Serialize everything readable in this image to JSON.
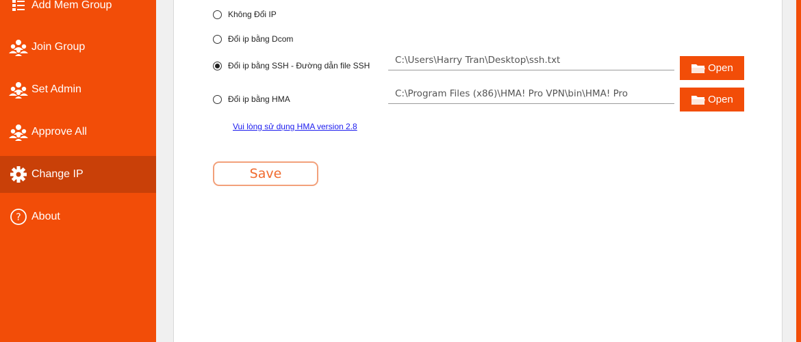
{
  "sidebar": {
    "items": [
      {
        "label": "Add Mem Group",
        "icon": "list-icon"
      },
      {
        "label": "Join Group",
        "icon": "group-icon"
      },
      {
        "label": "Set Admin",
        "icon": "group-icon"
      },
      {
        "label": "Approve All",
        "icon": "group-icon"
      },
      {
        "label": "Change IP",
        "icon": "gear-icon",
        "active": true
      },
      {
        "label": "About",
        "icon": "question-icon"
      }
    ]
  },
  "change_ip": {
    "options": [
      {
        "label": "Không Đổi IP",
        "checked": false
      },
      {
        "label": "Đổi ip bằng Dcom",
        "checked": false
      },
      {
        "label": "Đổi ip bằng SSH - Đường dẫn file SSH",
        "checked": true
      },
      {
        "label": "Đổi ip bằng HMA",
        "checked": false
      }
    ],
    "ssh_path": "C:\\Users\\Harry Tran\\Desktop\\ssh.txt",
    "hma_path": "C:\\Program Files (x86)\\HMA! Pro VPN\\bin\\HMA! Pro",
    "open_label": "Open",
    "hma_link": "Vui lòng sử dụng HMA version 2.8",
    "save_label": "Save"
  },
  "colors": {
    "accent": "#f24d08",
    "active_item": "#c94008",
    "link": "#1a1aee"
  }
}
